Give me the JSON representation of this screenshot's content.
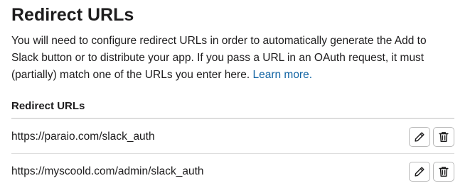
{
  "section": {
    "title": "Redirect URLs",
    "description": "You will need to configure redirect URLs in order to automatically generate the Add to Slack button or to distribute your app. If you pass a URL in an OAuth request, it must (partially) match one of the URLs you enter here.",
    "learn_more_label": "Learn more."
  },
  "list": {
    "header": "Redirect URLs",
    "rows": [
      {
        "url": "https://paraio.com/slack_auth"
      },
      {
        "url": "https://myscoold.com/admin/slack_auth"
      }
    ]
  },
  "icons": {
    "edit": "pencil-icon",
    "delete": "trash-icon"
  },
  "colors": {
    "link": "#1264a3",
    "text": "#1d1c1d",
    "divider": "#dddddd"
  }
}
